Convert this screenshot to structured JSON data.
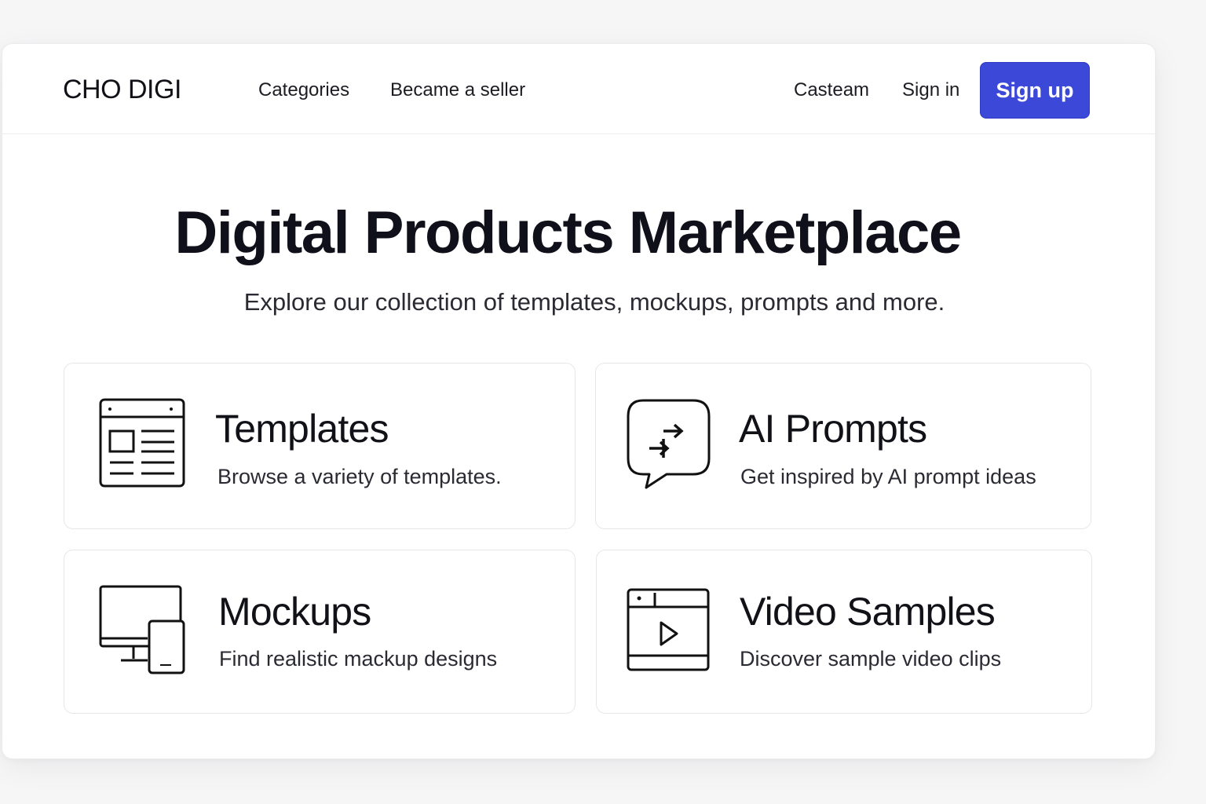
{
  "brand": {
    "name": "CHO DIGI",
    "accent_color": "#3b48d8"
  },
  "nav": {
    "left_links": [
      "Categories",
      "Became a seller"
    ],
    "right_links": [
      "Casteam",
      "Sign in"
    ],
    "signup_label": "Sign up"
  },
  "hero": {
    "title": "Digital Products Marketplace",
    "subtitle": "Explore our collection of templates, mockups, prompts and more."
  },
  "cards": [
    {
      "icon": "template-icon",
      "title": "Templates",
      "description": "Browse a variety of templates."
    },
    {
      "icon": "chat-arrows-icon",
      "title": "AI Prompts",
      "description": "Get inspired by AI prompt ideas"
    },
    {
      "icon": "devices-icon",
      "title": "Mockups",
      "description": "Find realistic mackup designs"
    },
    {
      "icon": "video-player-icon",
      "title": "Video Samples",
      "description": "Discover sample video clips"
    }
  ]
}
